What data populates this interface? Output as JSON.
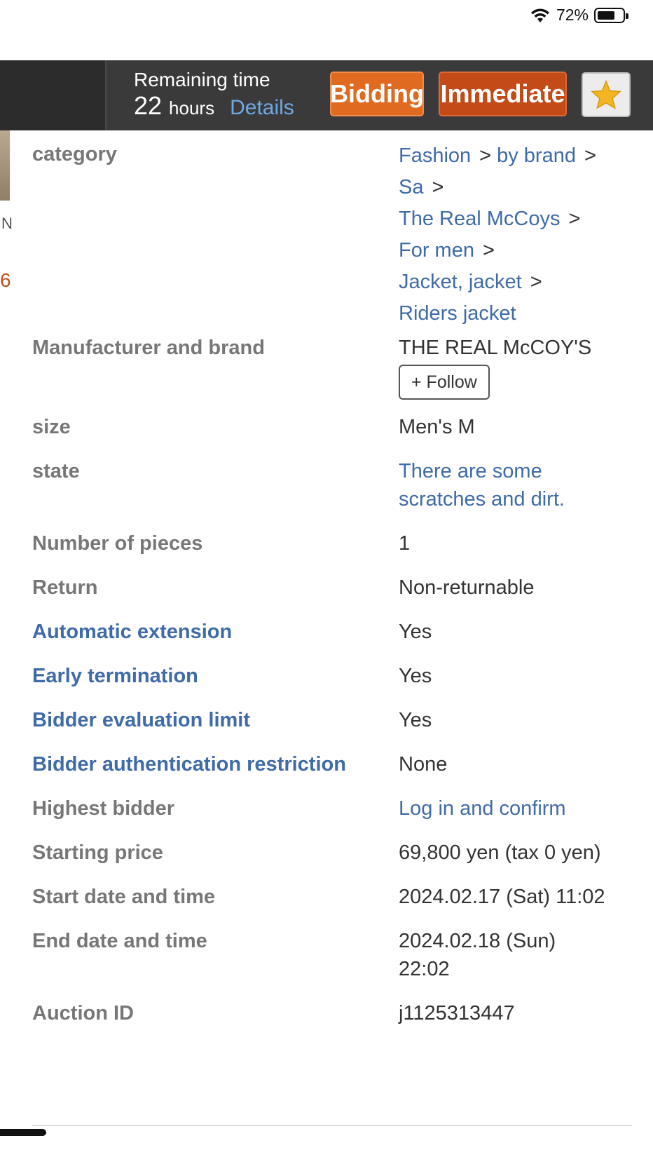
{
  "status_bar": {
    "battery_percent": "72%",
    "battery_level": 0.72
  },
  "auction_bar": {
    "remaining_label": "Remaining time",
    "remaining_value": "22",
    "remaining_unit": "hours",
    "details_label": "Details",
    "bid_button": "Bidding",
    "buy_now_button": "Immediate",
    "watch_icon": "star-icon"
  },
  "edge": {
    "letter": "N",
    "number": "6"
  },
  "details": {
    "category": {
      "label": "category",
      "crumbs": [
        "Fashion",
        "by brand",
        "Sa",
        "The Real McCoys",
        "For men",
        "Jacket, jacket",
        "Riders jacket"
      ]
    },
    "brand": {
      "label": "Manufacturer and brand",
      "value": "THE REAL McCOY'S",
      "follow": "+ Follow"
    },
    "size": {
      "label": "size",
      "value": "Men's M"
    },
    "state": {
      "label": "state",
      "value": "There are some scratches and dirt."
    },
    "pieces": {
      "label": "Number of pieces",
      "value": "1"
    },
    "return": {
      "label": "Return",
      "value": "Non-returnable"
    },
    "auto_ext": {
      "label": "Automatic extension",
      "value": "Yes"
    },
    "early_term": {
      "label": "Early termination",
      "value": "Yes"
    },
    "eval_limit": {
      "label": "Bidder evaluation limit",
      "value": "Yes"
    },
    "auth_restrict": {
      "label": "Bidder authentication restriction",
      "value": "None"
    },
    "highest_bidder": {
      "label": "Highest bidder",
      "value": "Log in and confirm"
    },
    "starting_price": {
      "label": "Starting price",
      "value": "69,800 yen (tax 0 yen)"
    },
    "start_date": {
      "label": "Start date and time",
      "value": "2024.02.17 (Sat) 11:02"
    },
    "end_date": {
      "label": "End date and time",
      "value": "2024.02.18 (Sun) 22:02"
    },
    "auction_id": {
      "label": "Auction ID",
      "value": "j1125313447"
    }
  },
  "colors": {
    "link": "#3f6ba8",
    "bid": "#e06a1f",
    "buy_now": "#c44a17",
    "bar": "#3a3a3a"
  }
}
